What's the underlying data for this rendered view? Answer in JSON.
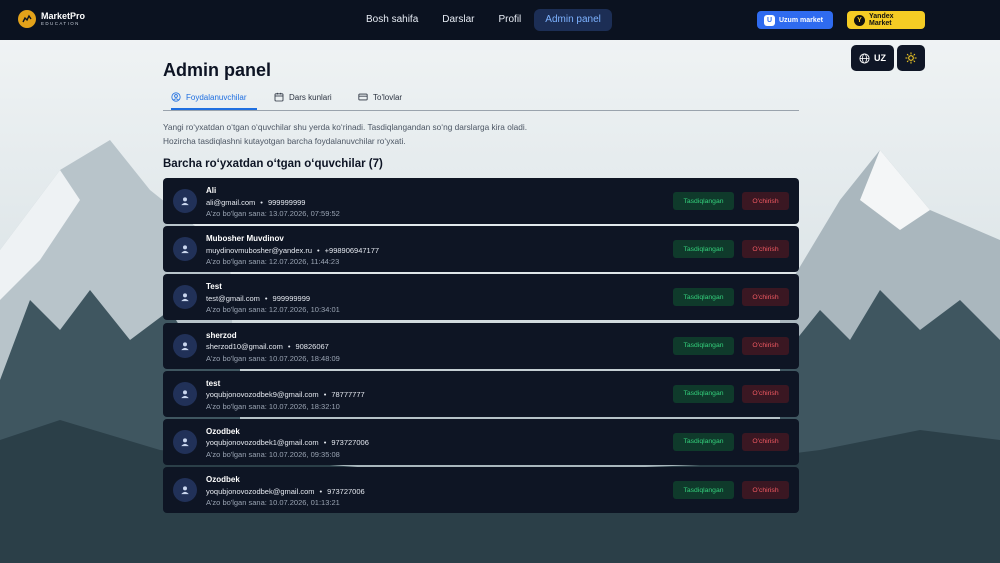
{
  "brand": {
    "name": "MarketPro",
    "subtitle": "EDUCATION"
  },
  "nav": {
    "links": [
      {
        "label": "Bosh sahifa"
      },
      {
        "label": "Darslar"
      },
      {
        "label": "Profil"
      },
      {
        "label": "Admin panel",
        "active": true
      }
    ],
    "uzum_label": "Uzum market",
    "uzum_icon": "U",
    "yandex_label": "Yandex Market",
    "yandex_icon": "Y"
  },
  "controls": {
    "language": "UZ",
    "language_icon": "globe-icon",
    "theme_icon": "sun-icon"
  },
  "page": {
    "title": "Admin panel",
    "tabs": [
      {
        "label": "Foydalanuvchilar",
        "icon": "user-circle-icon",
        "active": true
      },
      {
        "label": "Dars kunlari",
        "icon": "calendar-icon"
      },
      {
        "label": "To'lovlar",
        "icon": "card-icon"
      }
    ],
    "desc_line1": "Yangi ro‘yxatdan o‘tgan o‘quvchilar shu yerda ko‘rinadi. Tasdiqlangandan so‘ng darslarga kira oladi.",
    "desc_line2": "Hozircha tasdiqlashni kutayotgan barcha foydalanuvchilar ro‘yxati.",
    "section_title": "Barcha ro‘yxatdan o‘tgan o‘quvchilar (7)"
  },
  "users": [
    {
      "name": "Ali",
      "email": "ali@gmail.com",
      "phone": "999999999",
      "date": "A'zo bo'lgan sana: 13.07.2026, 07:59:52",
      "status": "Tasdiqlangan",
      "delete": "O'chirish"
    },
    {
      "name": "Mubosher Muvdinov",
      "email": "muydinovmubosher@yandex.ru",
      "phone": "+998906947177",
      "date": "A'zo bo'lgan sana: 12.07.2026, 11:44:23",
      "status": "Tasdiqlangan",
      "delete": "O'chirish"
    },
    {
      "name": "Test",
      "email": "test@gmail.com",
      "phone": "999999999",
      "date": "A'zo bo'lgan sana: 12.07.2026, 10:34:01",
      "status": "Tasdiqlangan",
      "delete": "O'chirish"
    },
    {
      "name": "sherzod",
      "email": "sherzod10@gmail.com",
      "phone": "90826067",
      "date": "A'zo bo'lgan sana: 10.07.2026, 18:48:09",
      "status": "Tasdiqlangan",
      "delete": "O'chirish"
    },
    {
      "name": "test",
      "email": "yoqubjonovozodbek9@gmail.com",
      "phone": "78777777",
      "date": "A'zo bo'lgan sana: 10.07.2026, 18:32:10",
      "status": "Tasdiqlangan",
      "delete": "O'chirish"
    },
    {
      "name": "Ozodbek",
      "email": "yoqubjonovozodbek1@gmail.com",
      "phone": "973727006",
      "date": "A'zo bo'lgan sana: 10.07.2026, 09:35:08",
      "status": "Tasdiqlangan",
      "delete": "O'chirish"
    },
    {
      "name": "Ozodbek",
      "email": "yoqubjonovozodbek@gmail.com",
      "phone": "973727006",
      "date": "A'zo bo'lgan sana: 10.07.2026, 01:13:21",
      "status": "Tasdiqlangan",
      "delete": "O'chirish"
    }
  ],
  "colors": {
    "navbar": "#0b1220",
    "accent": "#1f6fe0",
    "approved": "#34d07c",
    "delete": "#f35a63"
  }
}
